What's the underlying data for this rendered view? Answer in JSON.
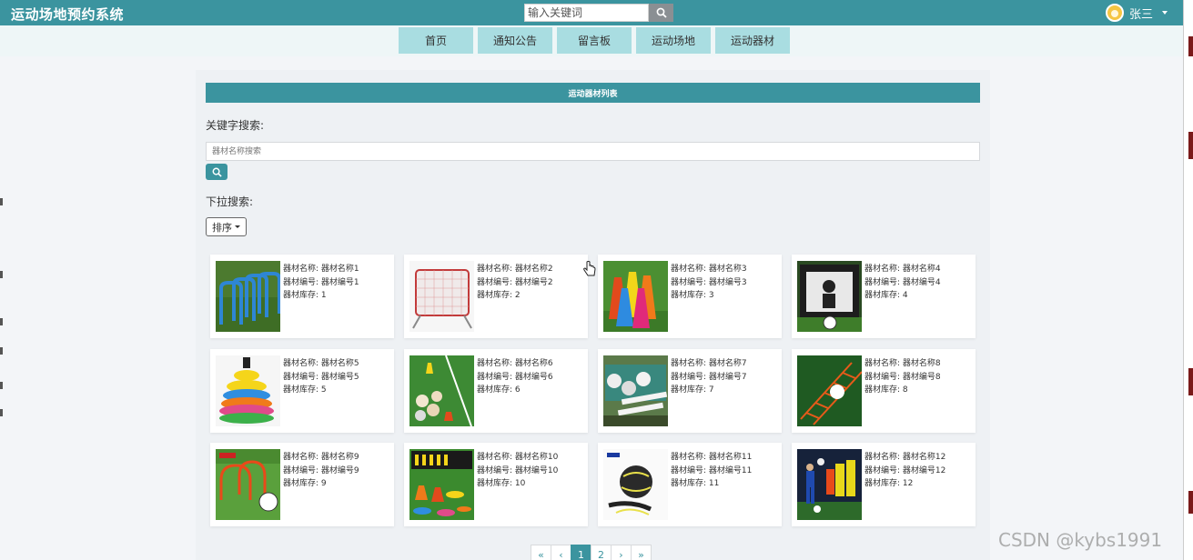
{
  "header": {
    "brand": "运动场地预约系统",
    "search_placeholder": "输入关键词",
    "search_icon": "search-icon",
    "user_name": "张三",
    "user_caret_icon": "caret-down-icon"
  },
  "nav": {
    "items": [
      {
        "label": "首页"
      },
      {
        "label": "通知公告"
      },
      {
        "label": "留言板"
      },
      {
        "label": "运动场地"
      },
      {
        "label": "运动器材"
      }
    ]
  },
  "list": {
    "title": "运动器材列表",
    "keyword_label": "关键字搜索:",
    "keyword_placeholder": "器材名称搜索",
    "dropdown_label": "下拉搜索:",
    "sort_label": "排序"
  },
  "items": [
    {
      "name": "器材名称: 器材名称1",
      "code": "器材编号: 器材编号1",
      "stock": "器材库存: 1",
      "image": "agility-hurdles"
    },
    {
      "name": "器材名称: 器材名称2",
      "code": "器材编号: 器材编号2",
      "stock": "器材库存: 2",
      "image": "rebound-net"
    },
    {
      "name": "器材名称: 器材名称3",
      "code": "器材编号: 器材编号3",
      "stock": "器材库存: 3",
      "image": "traffic-cones"
    },
    {
      "name": "器材名称: 器材名称4",
      "code": "器材编号: 器材编号4",
      "stock": "器材库存: 4",
      "image": "goal-target-net"
    },
    {
      "name": "器材名称: 器材名称5",
      "code": "器材编号: 器材编号5",
      "stock": "器材库存: 5",
      "image": "disc-cones-stack"
    },
    {
      "name": "器材名称: 器材名称6",
      "code": "器材编号: 器材编号6",
      "stock": "器材库存: 6",
      "image": "balls-on-field"
    },
    {
      "name": "器材名称: 器材名称7",
      "code": "器材编号: 器材编号7",
      "stock": "器材库存: 7",
      "image": "balls-in-crate"
    },
    {
      "name": "器材名称: 器材名称8",
      "code": "器材编号: 器材编号8",
      "stock": "器材库存: 8",
      "image": "agility-ladder"
    },
    {
      "name": "器材名称: 器材名称9",
      "code": "器材编号: 器材编号9",
      "stock": "器材库存: 9",
      "image": "training-arches"
    },
    {
      "name": "器材名称: 器材名称10",
      "code": "器材编号: 器材编号10",
      "stock": "器材库存: 10",
      "image": "training-set"
    },
    {
      "name": "器材名称: 器材名称11",
      "code": "器材编号: 器材编号11",
      "stock": "器材库存: 11",
      "image": "ball-kick-trainer"
    },
    {
      "name": "器材名称: 器材名称12",
      "code": "器材编号: 器材编号12",
      "stock": "器材库存: 12",
      "image": "players-training"
    }
  ],
  "pagination": {
    "first": "«",
    "prev": "‹",
    "pages": [
      "1",
      "2"
    ],
    "current": "1",
    "next": "›",
    "last": "»"
  },
  "watermark": "CSDN @kybs1991",
  "colors": {
    "primary": "#3b949f",
    "nav_tab": "#a9dde1",
    "background": "#f3f5f8"
  }
}
